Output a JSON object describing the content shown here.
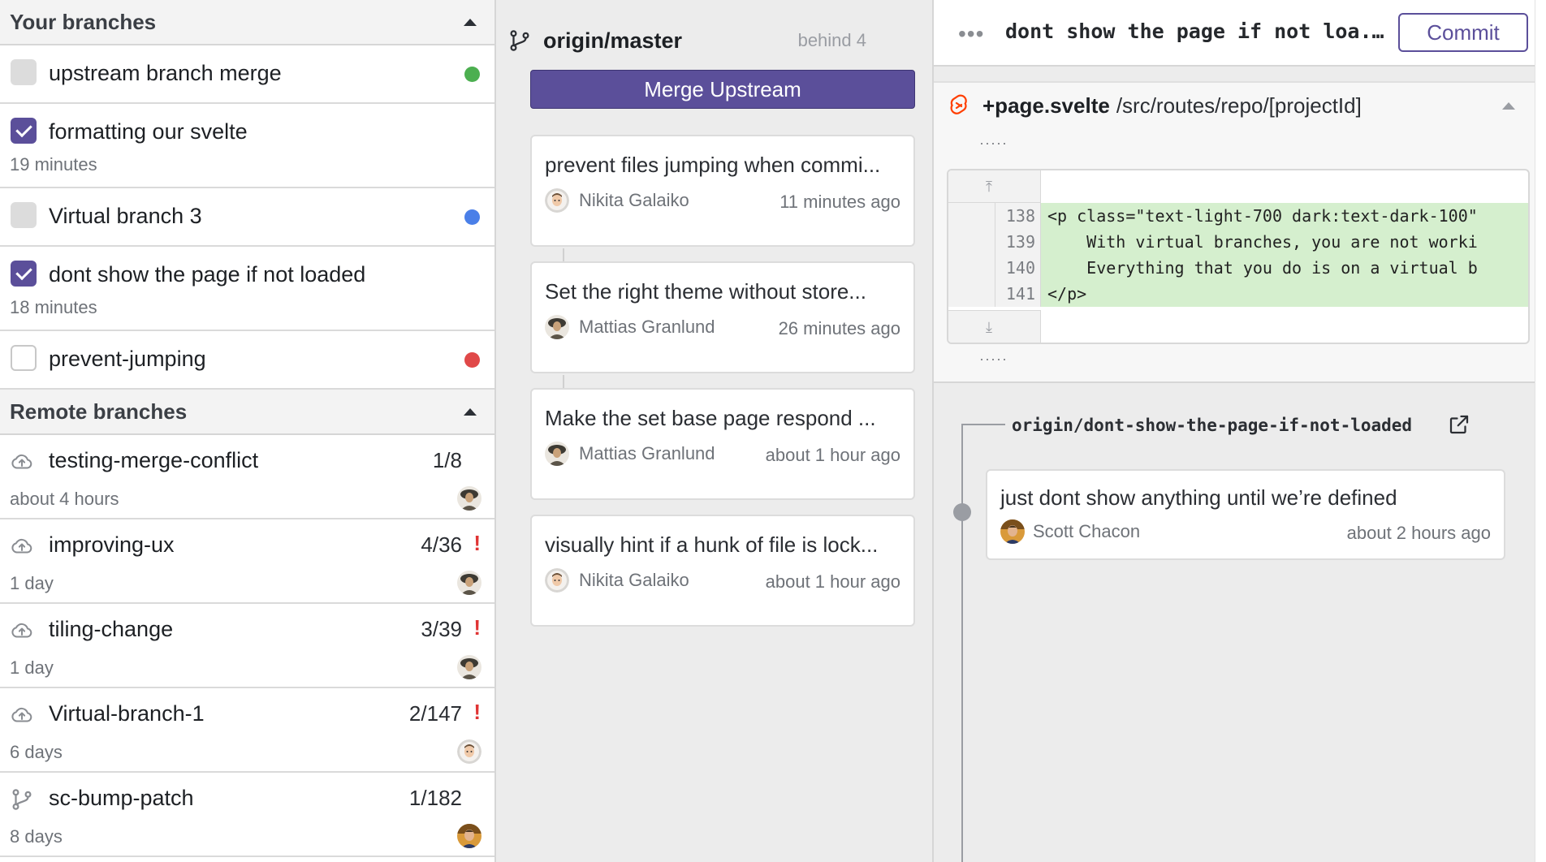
{
  "sidebar": {
    "your_branches_title": "Your branches",
    "remote_branches_title": "Remote branches",
    "virtual_branches": [
      {
        "name": "upstream branch merge",
        "sub": "",
        "checked": false,
        "dot_color": "#4caf50"
      },
      {
        "name": "formatting our svelte",
        "sub": "19 minutes",
        "checked": true,
        "dot_color": ""
      },
      {
        "name": "Virtual branch 3",
        "sub": "",
        "checked": false,
        "dot_color": "#4a7fe8"
      },
      {
        "name": "dont show the page if not loaded",
        "sub": "18 minutes",
        "checked": true,
        "dot_color": ""
      },
      {
        "name": "prevent-jumping",
        "sub": "",
        "checked": false,
        "dot_color": "#e04848"
      }
    ],
    "remote_branches": [
      {
        "name": "testing-merge-conflict",
        "count": "1/8",
        "warn": "",
        "sub": "about 4 hours",
        "icon": "cloud-upload-icon",
        "avatar": "mattias"
      },
      {
        "name": "improving-ux",
        "count": "4/36",
        "warn": "!",
        "sub": "1 day",
        "icon": "cloud-upload-icon",
        "avatar": "mattias"
      },
      {
        "name": "tiling-change",
        "count": "3/39",
        "warn": "!",
        "sub": "1 day",
        "icon": "cloud-upload-icon",
        "avatar": "mattias"
      },
      {
        "name": "Virtual-branch-1",
        "count": "2/147",
        "warn": "!",
        "sub": "6 days",
        "icon": "cloud-upload-icon",
        "avatar": "nikita"
      },
      {
        "name": "sc-bump-patch",
        "count": "1/182",
        "warn": "",
        "sub": "8 days",
        "icon": "git-branch-icon",
        "avatar": "scott"
      }
    ]
  },
  "upstream": {
    "branch": "origin/master",
    "behind": "behind 4",
    "merge_label": "Merge Upstream",
    "commits": [
      {
        "message": "prevent files jumping when commi...",
        "author": "Nikita Galaiko",
        "time": "11 minutes ago",
        "avatar": "nikita"
      },
      {
        "message": "Set the right theme without store...",
        "author": "Mattias Granlund",
        "time": "26 minutes ago",
        "avatar": "mattias"
      },
      {
        "message": "Make the set base page respond ...",
        "author": "Mattias Granlund",
        "time": "about 1 hour ago",
        "avatar": "mattias"
      },
      {
        "message": "visually hint if a hunk of file is lock...",
        "author": "Nikita Galaiko",
        "time": "about 1 hour ago",
        "avatar": "nikita"
      }
    ]
  },
  "branch_view": {
    "dots": "•••",
    "title": "dont show the page if not loa...",
    "commit_label": "Commit",
    "file": {
      "name": "+page.svelte",
      "path": "/src/routes/repo/[projectId]",
      "ellipsis_top": "·····",
      "ellipsis_bottom": "·····",
      "expand_up": "⤒",
      "expand_down": "⤓",
      "lines": [
        {
          "num": "138",
          "code": "<p class=\"text-light-700 dark:text-dark-100\""
        },
        {
          "num": "139",
          "code": "    With virtual branches, you are not worki"
        },
        {
          "num": "140",
          "code": "    Everything that you do is on a virtual b"
        },
        {
          "num": "141",
          "code": "</p>"
        }
      ]
    },
    "remote": {
      "name": "origin/dont-show-the-page-if-not-loaded",
      "commit_message": "just dont show anything until we’re defined",
      "commit_author": "Scott Chacon",
      "commit_time": "about 2 hours ago"
    }
  },
  "colors": {
    "accent": "#5b4f9a",
    "warn": "#e03434",
    "diff_add": "#d5efce",
    "svelte_brand": "#ff3e00"
  }
}
